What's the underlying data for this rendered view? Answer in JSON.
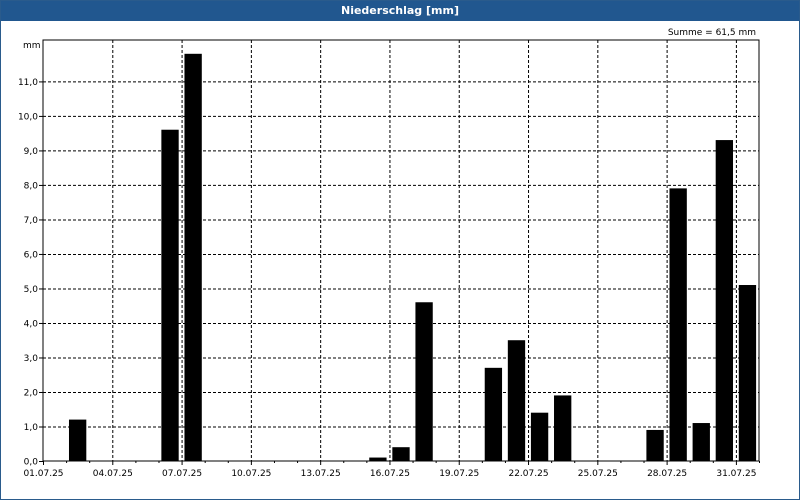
{
  "window": {
    "title": "Niederschlag [mm]"
  },
  "chart_data": {
    "type": "bar",
    "title": "Niederschlag [mm]",
    "ylabel": "mm",
    "xlabel": "",
    "annotation": "Summe = 61,5 mm",
    "ylim": [
      0,
      12.2
    ],
    "yticks": [
      0,
      1,
      2,
      3,
      4,
      5,
      6,
      7,
      8,
      9,
      10,
      11
    ],
    "ytick_labels": [
      "0,0",
      "1,0",
      "2,0",
      "3,0",
      "4,0",
      "5,0",
      "6,0",
      "7,0",
      "8,0",
      "9,0",
      "10,0",
      "11,0"
    ],
    "xlim": [
      "01.07.25",
      "01.08.25"
    ],
    "xtick_labels": [
      "01.07.25",
      "04.07.25",
      "07.07.25",
      "10.07.25",
      "13.07.25",
      "16.07.25",
      "19.07.25",
      "22.07.25",
      "25.07.25",
      "28.07.25",
      "31.07.25"
    ],
    "grid": true,
    "bar_color": "#000000",
    "categories": [
      "01.07.25",
      "02.07.25",
      "03.07.25",
      "04.07.25",
      "05.07.25",
      "06.07.25",
      "07.07.25",
      "08.07.25",
      "09.07.25",
      "10.07.25",
      "11.07.25",
      "12.07.25",
      "13.07.25",
      "14.07.25",
      "15.07.25",
      "16.07.25",
      "17.07.25",
      "18.07.25",
      "19.07.25",
      "20.07.25",
      "21.07.25",
      "22.07.25",
      "23.07.25",
      "24.07.25",
      "25.07.25",
      "26.07.25",
      "27.07.25",
      "28.07.25",
      "29.07.25",
      "30.07.25",
      "31.07.25"
    ],
    "values": [
      0,
      1.2,
      0,
      0,
      0,
      9.6,
      11.8,
      0,
      0,
      0,
      0,
      0,
      0,
      0,
      0.1,
      0.4,
      4.6,
      0,
      0,
      2.7,
      3.5,
      1.4,
      1.9,
      0,
      0,
      0,
      0.9,
      7.9,
      1.1,
      9.3,
      5.1
    ]
  }
}
